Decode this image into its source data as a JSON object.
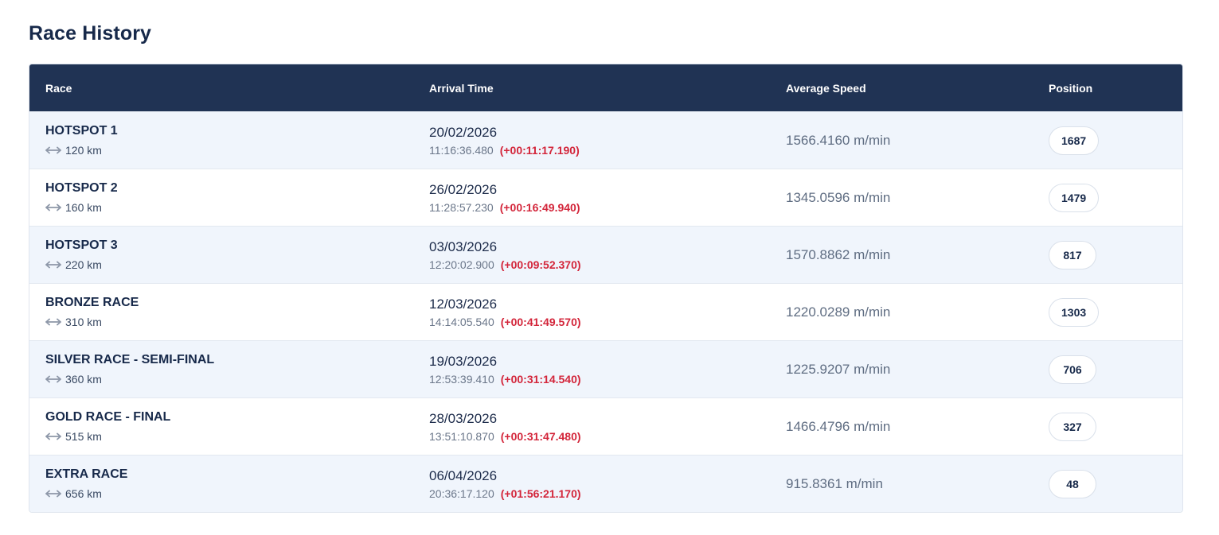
{
  "page": {
    "title": "Race History"
  },
  "table": {
    "headers": {
      "race": "Race",
      "arrival": "Arrival Time",
      "speed": "Average Speed",
      "position": "Position"
    },
    "rows": [
      {
        "race": "HOTSPOT 1",
        "distance": "120 km",
        "date": "20/02/2026",
        "time": "11:16:36.480",
        "delta": "(+00:11:17.190)",
        "speed": "1566.4160 m/min",
        "position": "1687"
      },
      {
        "race": "HOTSPOT 2",
        "distance": "160 km",
        "date": "26/02/2026",
        "time": "11:28:57.230",
        "delta": "(+00:16:49.940)",
        "speed": "1345.0596 m/min",
        "position": "1479"
      },
      {
        "race": "HOTSPOT 3",
        "distance": "220 km",
        "date": "03/03/2026",
        "time": "12:20:02.900",
        "delta": "(+00:09:52.370)",
        "speed": "1570.8862 m/min",
        "position": "817"
      },
      {
        "race": "BRONZE RACE",
        "distance": "310 km",
        "date": "12/03/2026",
        "time": "14:14:05.540",
        "delta": "(+00:41:49.570)",
        "speed": "1220.0289 m/min",
        "position": "1303"
      },
      {
        "race": "SILVER RACE - SEMI-FINAL",
        "distance": "360 km",
        "date": "19/03/2026",
        "time": "12:53:39.410",
        "delta": "(+00:31:14.540)",
        "speed": "1225.9207 m/min",
        "position": "706"
      },
      {
        "race": "GOLD RACE - FINAL",
        "distance": "515 km",
        "date": "28/03/2026",
        "time": "13:51:10.870",
        "delta": "(+00:31:47.480)",
        "speed": "1466.4796 m/min",
        "position": "327"
      },
      {
        "race": "EXTRA RACE",
        "distance": "656 km",
        "date": "06/04/2026",
        "time": "20:36:17.120",
        "delta": "(+01:56:21.170)",
        "speed": "915.8361 m/min",
        "position": "48"
      }
    ]
  },
  "icons": {
    "distance": "horizontal-double-arrow-icon"
  },
  "colors": {
    "header_bg": "#203354",
    "alt_row_bg": "#f0f5fc",
    "delta_red": "#d3253a",
    "title_navy": "#17294a"
  }
}
